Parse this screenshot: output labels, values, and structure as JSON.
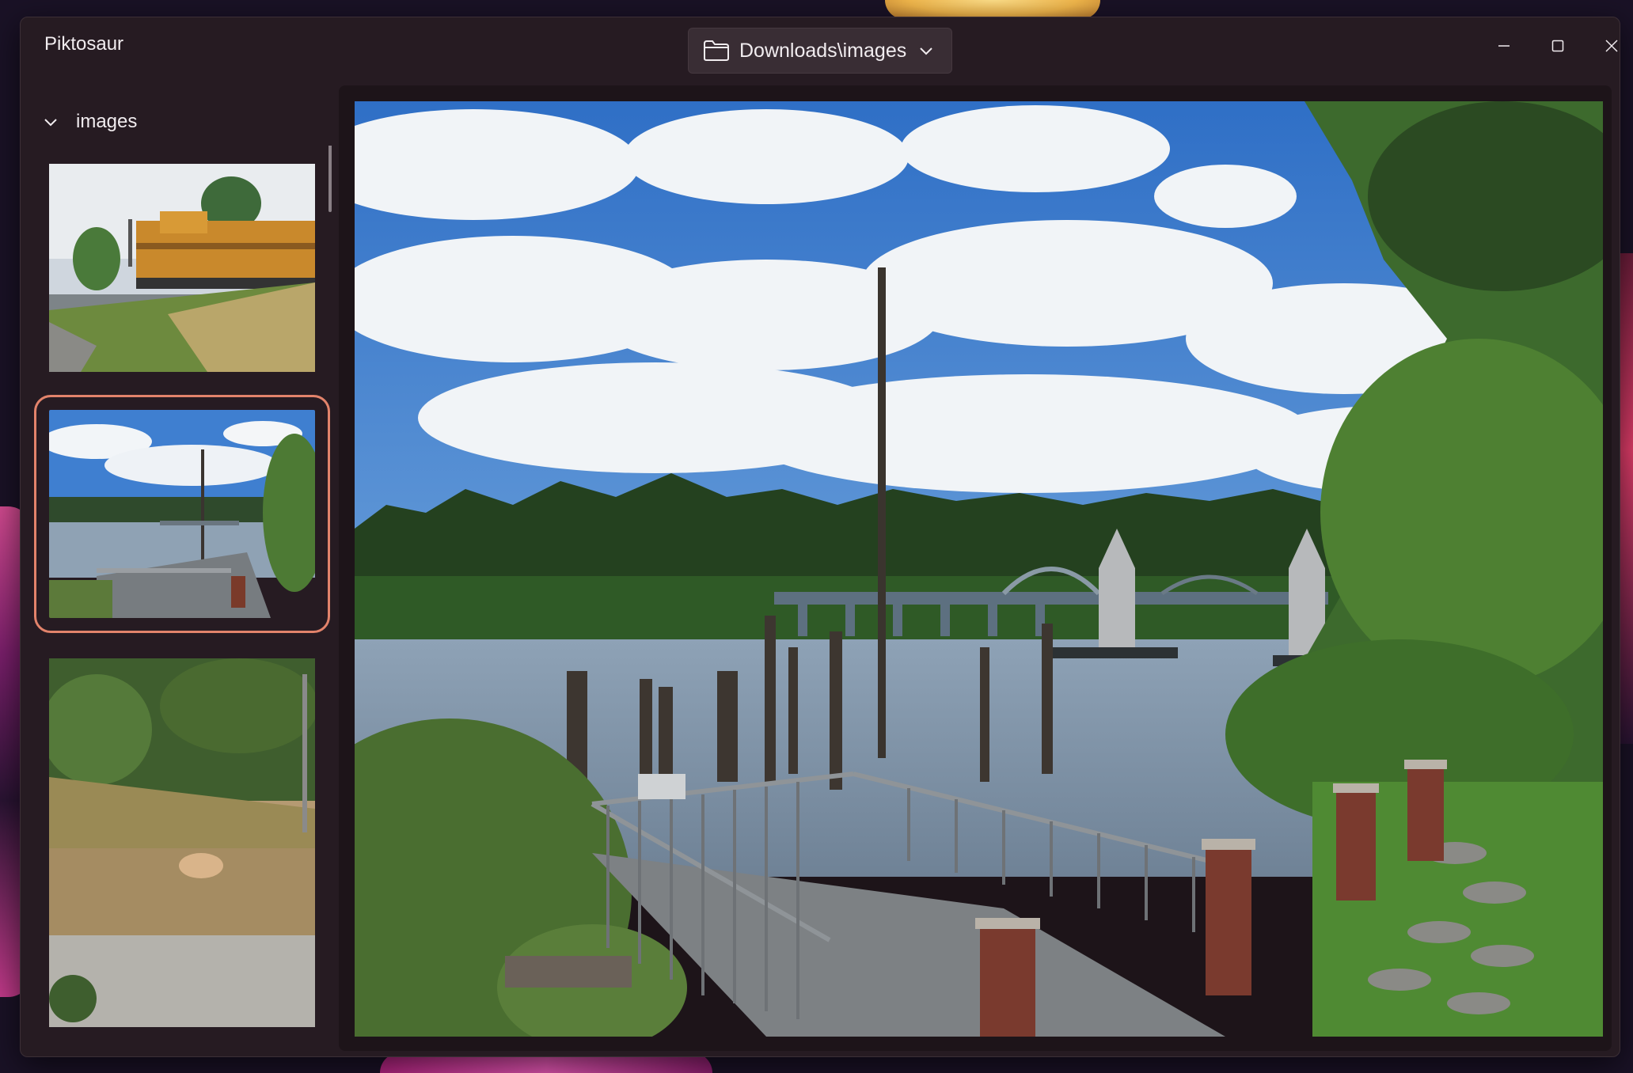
{
  "window": {
    "app_title": "Piktosaur",
    "path_label": "Downloads\\images"
  },
  "sidebar": {
    "folder_name": "images",
    "thumbnails": [
      {
        "name": "train-photo",
        "selected": false
      },
      {
        "name": "river-bridge-photo",
        "selected": true
      },
      {
        "name": "cat-photo",
        "selected": false
      },
      {
        "name": "partial-photo",
        "selected": false
      }
    ]
  },
  "colors": {
    "window_bg": "#261b22",
    "selection_accent": "#e2836b",
    "text": "#f1ecef"
  },
  "icons": {
    "path": "folder-icon",
    "path_dropdown": "chevron-down-icon",
    "tree_toggle": "chevron-down-icon",
    "minimize": "minimize-icon",
    "maximize": "maximize-icon",
    "close": "close-icon"
  }
}
